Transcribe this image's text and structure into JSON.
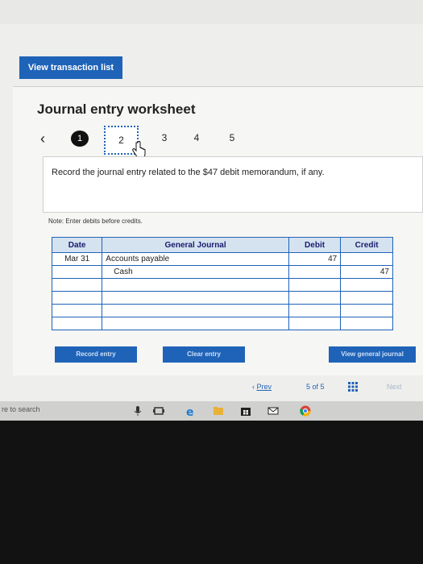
{
  "toolbar": {
    "view_transactions_label": "View transaction list"
  },
  "worksheet": {
    "title": "Journal entry worksheet",
    "steps": [
      "1",
      "2",
      "3",
      "4",
      "5"
    ],
    "current_step": 2,
    "instruction": "Record the journal entry related to the $47 debit memorandum, if any.",
    "note": "Note: Enter debits before credits."
  },
  "journal": {
    "headers": {
      "date": "Date",
      "account": "General Journal",
      "debit": "Debit",
      "credit": "Credit"
    },
    "rows": [
      {
        "date": "Mar 31",
        "account": "Accounts payable",
        "debit": "47",
        "credit": ""
      },
      {
        "date": "",
        "account": "Cash",
        "debit": "",
        "credit": "47"
      },
      {
        "date": "",
        "account": "",
        "debit": "",
        "credit": ""
      },
      {
        "date": "",
        "account": "",
        "debit": "",
        "credit": ""
      },
      {
        "date": "",
        "account": "",
        "debit": "",
        "credit": ""
      },
      {
        "date": "",
        "account": "",
        "debit": "",
        "credit": ""
      }
    ]
  },
  "actions": {
    "record": "Record entry",
    "clear": "Clear entry",
    "view_general": "View general journal"
  },
  "pagination": {
    "prev": "Prev",
    "position": "5 of 5",
    "next": "Next"
  },
  "taskbar": {
    "search_text": "re to search"
  },
  "colors": {
    "accent": "#1f63b8",
    "header_bg": "#d5e2f0"
  }
}
